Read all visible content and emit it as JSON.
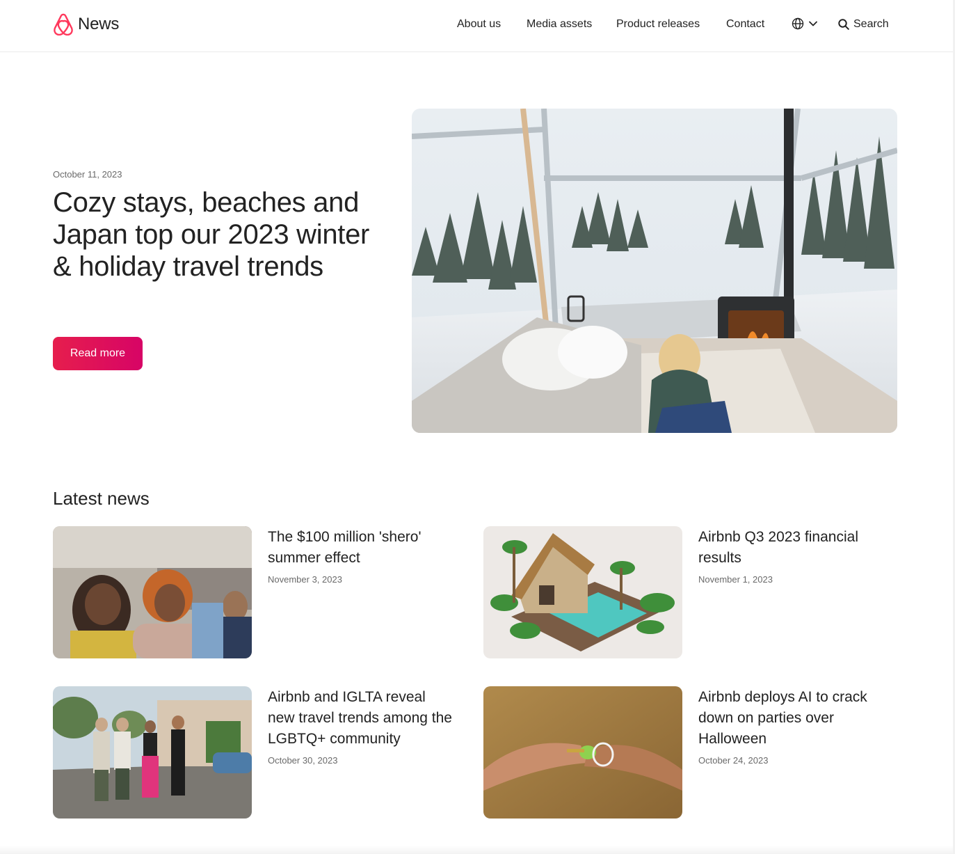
{
  "header": {
    "logo_text": "News",
    "nav": [
      "About us",
      "Media assets",
      "Product releases",
      "Contact"
    ],
    "search_label": "Search",
    "language_icon": "globe-icon",
    "brand_color": "#ff385c"
  },
  "hero": {
    "date": "October 11, 2023",
    "title": "Cozy stays, beaches and Japan top our 2023 winter & holiday travel trends",
    "button_label": "Read more",
    "button_color": "#e61e4d"
  },
  "latest": {
    "heading": "Latest news",
    "articles": [
      {
        "title": "The $100 million 'shero' summer effect",
        "date": "November 3, 2023"
      },
      {
        "title": "Airbnb Q3 2023 financial results",
        "date": "November 1, 2023"
      },
      {
        "title": "Airbnb and IGLTA reveal new travel trends among the LGBTQ+ community",
        "date": "October 30, 2023"
      },
      {
        "title": "Airbnb deploys AI to crack down on parties over Halloween",
        "date": "October 24, 2023"
      }
    ]
  }
}
